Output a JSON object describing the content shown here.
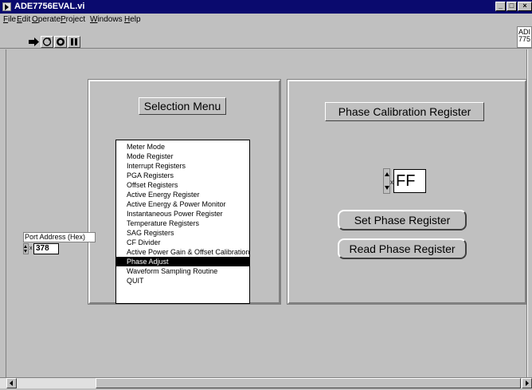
{
  "window": {
    "title": "ADE7756EVAL.vi"
  },
  "menu": [
    "File",
    "Edit",
    "Operate",
    "Project",
    "Windows",
    "Help"
  ],
  "toolbar": {
    "buttons": [
      "run-arrow-icon",
      "run-continuous-icon",
      "abort-icon",
      "pause-icon"
    ]
  },
  "right_clip_text": "ADI 775",
  "selection_menu": {
    "label": "Selection Menu",
    "items": [
      "Meter Mode",
      "Mode Register",
      "Interrupt Registers",
      "PGA Registers",
      "Offset Registers",
      "Active Energy Register",
      "Active Energy &  Power Monitor",
      "Instantaneous Power Register",
      "Temperature Registers",
      "SAG Registers",
      "CF Divider",
      "Active Power Gain & Offset Calibration",
      "Phase Adjust",
      "Waveform Sampling Routine",
      "QUIT"
    ],
    "selected_index": 12
  },
  "phase_panel": {
    "label": "Phase Calibration Register",
    "radix_mark": "x",
    "value": "FF",
    "set_button": "Set Phase Register",
    "read_button": "Read Phase Register"
  },
  "port": {
    "label": "Port Address (Hex)",
    "radix_mark": "x",
    "value": "378"
  }
}
